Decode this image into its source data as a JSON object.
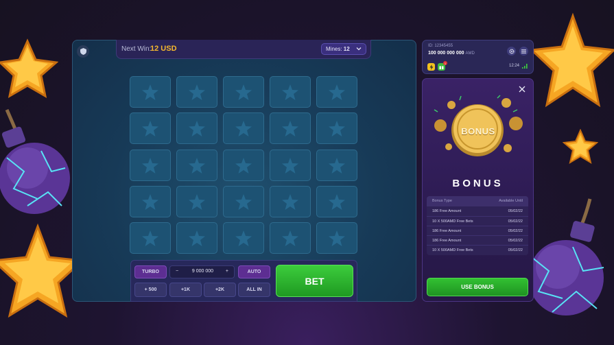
{
  "header": {
    "next_win_label": "Next Win:",
    "next_win_value": "12 USD",
    "mines_label": "Mines:",
    "mines_value": "12"
  },
  "controls": {
    "turbo_label": "TURBO",
    "bet_amount": "9 000 000",
    "minus": "−",
    "plus": "+",
    "auto_label": "AUTO",
    "quick_buttons": [
      "+ 500",
      "+1K",
      "+2K",
      "ALL IN"
    ],
    "bet_label": "BET"
  },
  "account": {
    "id": "ID: 12345455",
    "balance": "100 000 000 000",
    "currency": "AMD",
    "time": "12:24",
    "notification_count": "1"
  },
  "bonus": {
    "coin_text": "BONUS",
    "title": "BONUS",
    "close_icon": "✕",
    "table_headers": [
      "Bonus Type",
      "Available Until"
    ],
    "rows": [
      {
        "type": "186 Free Amount",
        "until": "05/02/22"
      },
      {
        "type": "10 X 500AMD  Free Bets",
        "until": "05/02/22"
      },
      {
        "type": "186 Free Amount",
        "until": "05/02/22"
      },
      {
        "type": "186 Free Amount",
        "until": "05/02/22"
      },
      {
        "type": "10 X 500AMD  Free Bets",
        "until": "05/02/22"
      }
    ],
    "use_bonus_label": "USE BONUS"
  },
  "colors": {
    "accent_gold": "#f5b82e",
    "bet_green": "#2db52d",
    "panel_purple": "#2a2756",
    "tile_blue": "#1d5273"
  },
  "icons": {
    "shield": "shield-icon",
    "star_tile": "star-icon",
    "gear": "gear-icon",
    "menu": "menu-icon",
    "close": "close-icon"
  }
}
